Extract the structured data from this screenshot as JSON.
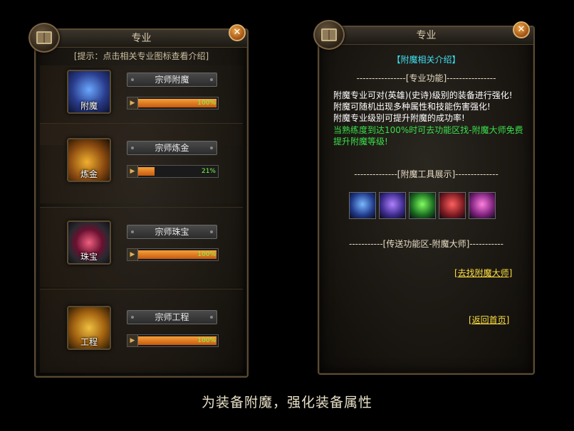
{
  "left": {
    "title": "专业",
    "close_glyph": "✕",
    "hint": "[提示：点击相关专业图标查看介绍]",
    "skills": [
      {
        "icon": "enchant-glove-icon",
        "label": "附魔",
        "name": "宗师附魔",
        "progress_text": "100%",
        "progress": 1.0
      },
      {
        "icon": "alchemy-flask-icon",
        "label": "炼金",
        "name": "宗师炼金",
        "progress_text": "21%",
        "progress": 0.21
      },
      {
        "icon": "jewel-gem-icon",
        "label": "珠宝",
        "name": "宗师珠宝",
        "progress_text": "100%",
        "progress": 1.0
      },
      {
        "icon": "engineering-gear-icon",
        "label": "工程",
        "name": "宗师工程",
        "progress_text": "100%",
        "progress": 1.0
      }
    ]
  },
  "right": {
    "title": "专业",
    "close_glyph": "✕",
    "heading": "【附魔相关介绍】",
    "sep1": "----------------[专业功能]----------------",
    "lines": [
      "附魔专业可对(英雄)(史诗)级别的装备进行强化!",
      "附魔可随机出现多种属性和技能伤害强化!",
      "附魔专业级别可提升附魔的成功率!"
    ],
    "green_line1": "当熟练度到达100%时可去功能区找-附魔大师免费",
    "green_line2": "提升附魔等级!",
    "sep2": "--------------[附魔工具展示]--------------",
    "tools": [
      "blue-glove-icon",
      "purple-glove-icon",
      "green-glove-icon",
      "red-glove-icon",
      "pink-glove-icon"
    ],
    "sep3": "-----------[传送功能区-附魔大师]-----------",
    "link_master": "[去找附魔大师]",
    "link_home": "[返回首页]"
  },
  "caption": "为装备附魔，强化装备属性",
  "colors": {
    "green": "#39e04a",
    "cyan": "#3ee0f0",
    "yellow": "#ffe040",
    "progress": "#e8801c"
  }
}
